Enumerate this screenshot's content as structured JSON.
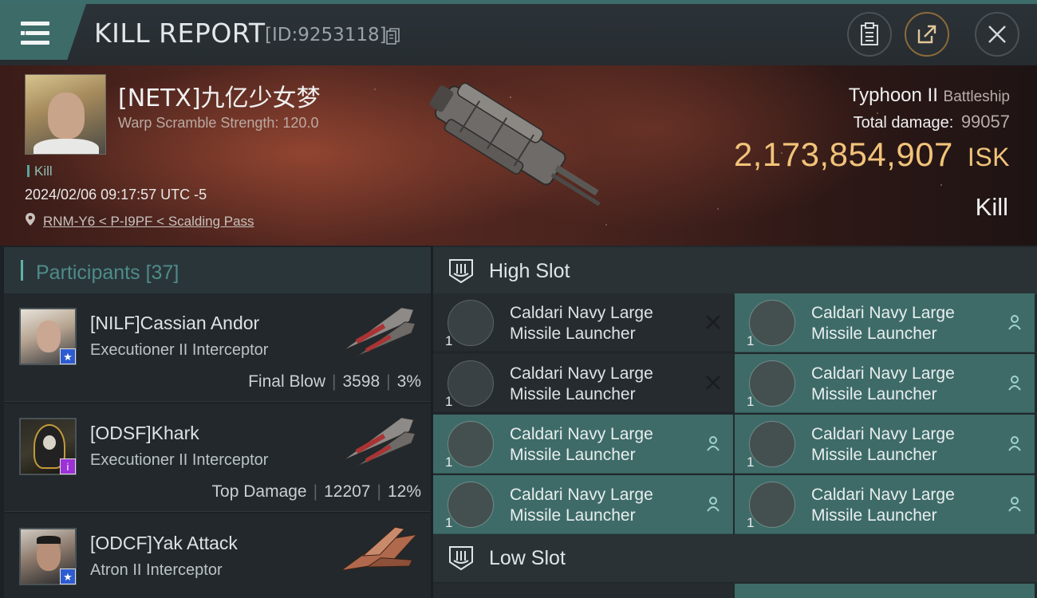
{
  "header": {
    "title": "KILL REPORT",
    "report_id": "[ID:9253118]",
    "icons": [
      "menu-icon",
      "copy-icon",
      "clipboard-icon",
      "share-icon",
      "close-icon"
    ]
  },
  "victim": {
    "name": "[NETX]九亿少女梦",
    "warp_scramble": "Warp Scramble Strength: 120.0",
    "kill_tag": "Kill",
    "datetime": "2024/02/06 09:17:57 UTC -5",
    "location": "RNM-Y6 < P-I9PF < Scalding Pass",
    "ship_name": "Typhoon II",
    "ship_class": "Battleship",
    "total_damage_label": "Total damage:",
    "total_damage": "99057",
    "isk_value": "2,173,854,907",
    "isk_unit": "ISK",
    "kill_type": "Kill",
    "isk_color": "#f1c37a"
  },
  "participants": {
    "title": "Participants",
    "count": "[37]",
    "rows": [
      {
        "name": "[NILF]Cassian Andor",
        "ship": "Executioner II Interceptor",
        "role": "Final Blow",
        "damage": "3598",
        "percent": "3%",
        "badge": "★"
      },
      {
        "name": "[ODSF]Khark",
        "ship": "Executioner II Interceptor",
        "role": "Top Damage",
        "damage": "12207",
        "percent": "12%",
        "badge": "i"
      },
      {
        "name": "[ODCF]Yak Attack",
        "ship": "Atron II Interceptor",
        "badge": "★"
      }
    ]
  },
  "slots": {
    "high": {
      "title": "High Slot",
      "modules": [
        {
          "name": "Caldari Navy Large Missile Launcher",
          "qty": "1",
          "status": "destroyed"
        },
        {
          "name": "Caldari Navy Large Missile Launcher",
          "qty": "1",
          "status": "dropped"
        },
        {
          "name": "Caldari Navy Large Missile Launcher",
          "qty": "1",
          "status": "destroyed"
        },
        {
          "name": "Caldari Navy Large Missile Launcher",
          "qty": "1",
          "status": "dropped"
        },
        {
          "name": "Caldari Navy Large Missile Launcher",
          "qty": "1",
          "status": "dropped"
        },
        {
          "name": "Caldari Navy Large Missile Launcher",
          "qty": "1",
          "status": "dropped"
        },
        {
          "name": "Caldari Navy Large Missile Launcher",
          "qty": "1",
          "status": "dropped"
        },
        {
          "name": "Caldari Navy Large Missile Launcher",
          "qty": "1",
          "status": "dropped"
        }
      ]
    },
    "low": {
      "title": "Low Slot"
    }
  }
}
